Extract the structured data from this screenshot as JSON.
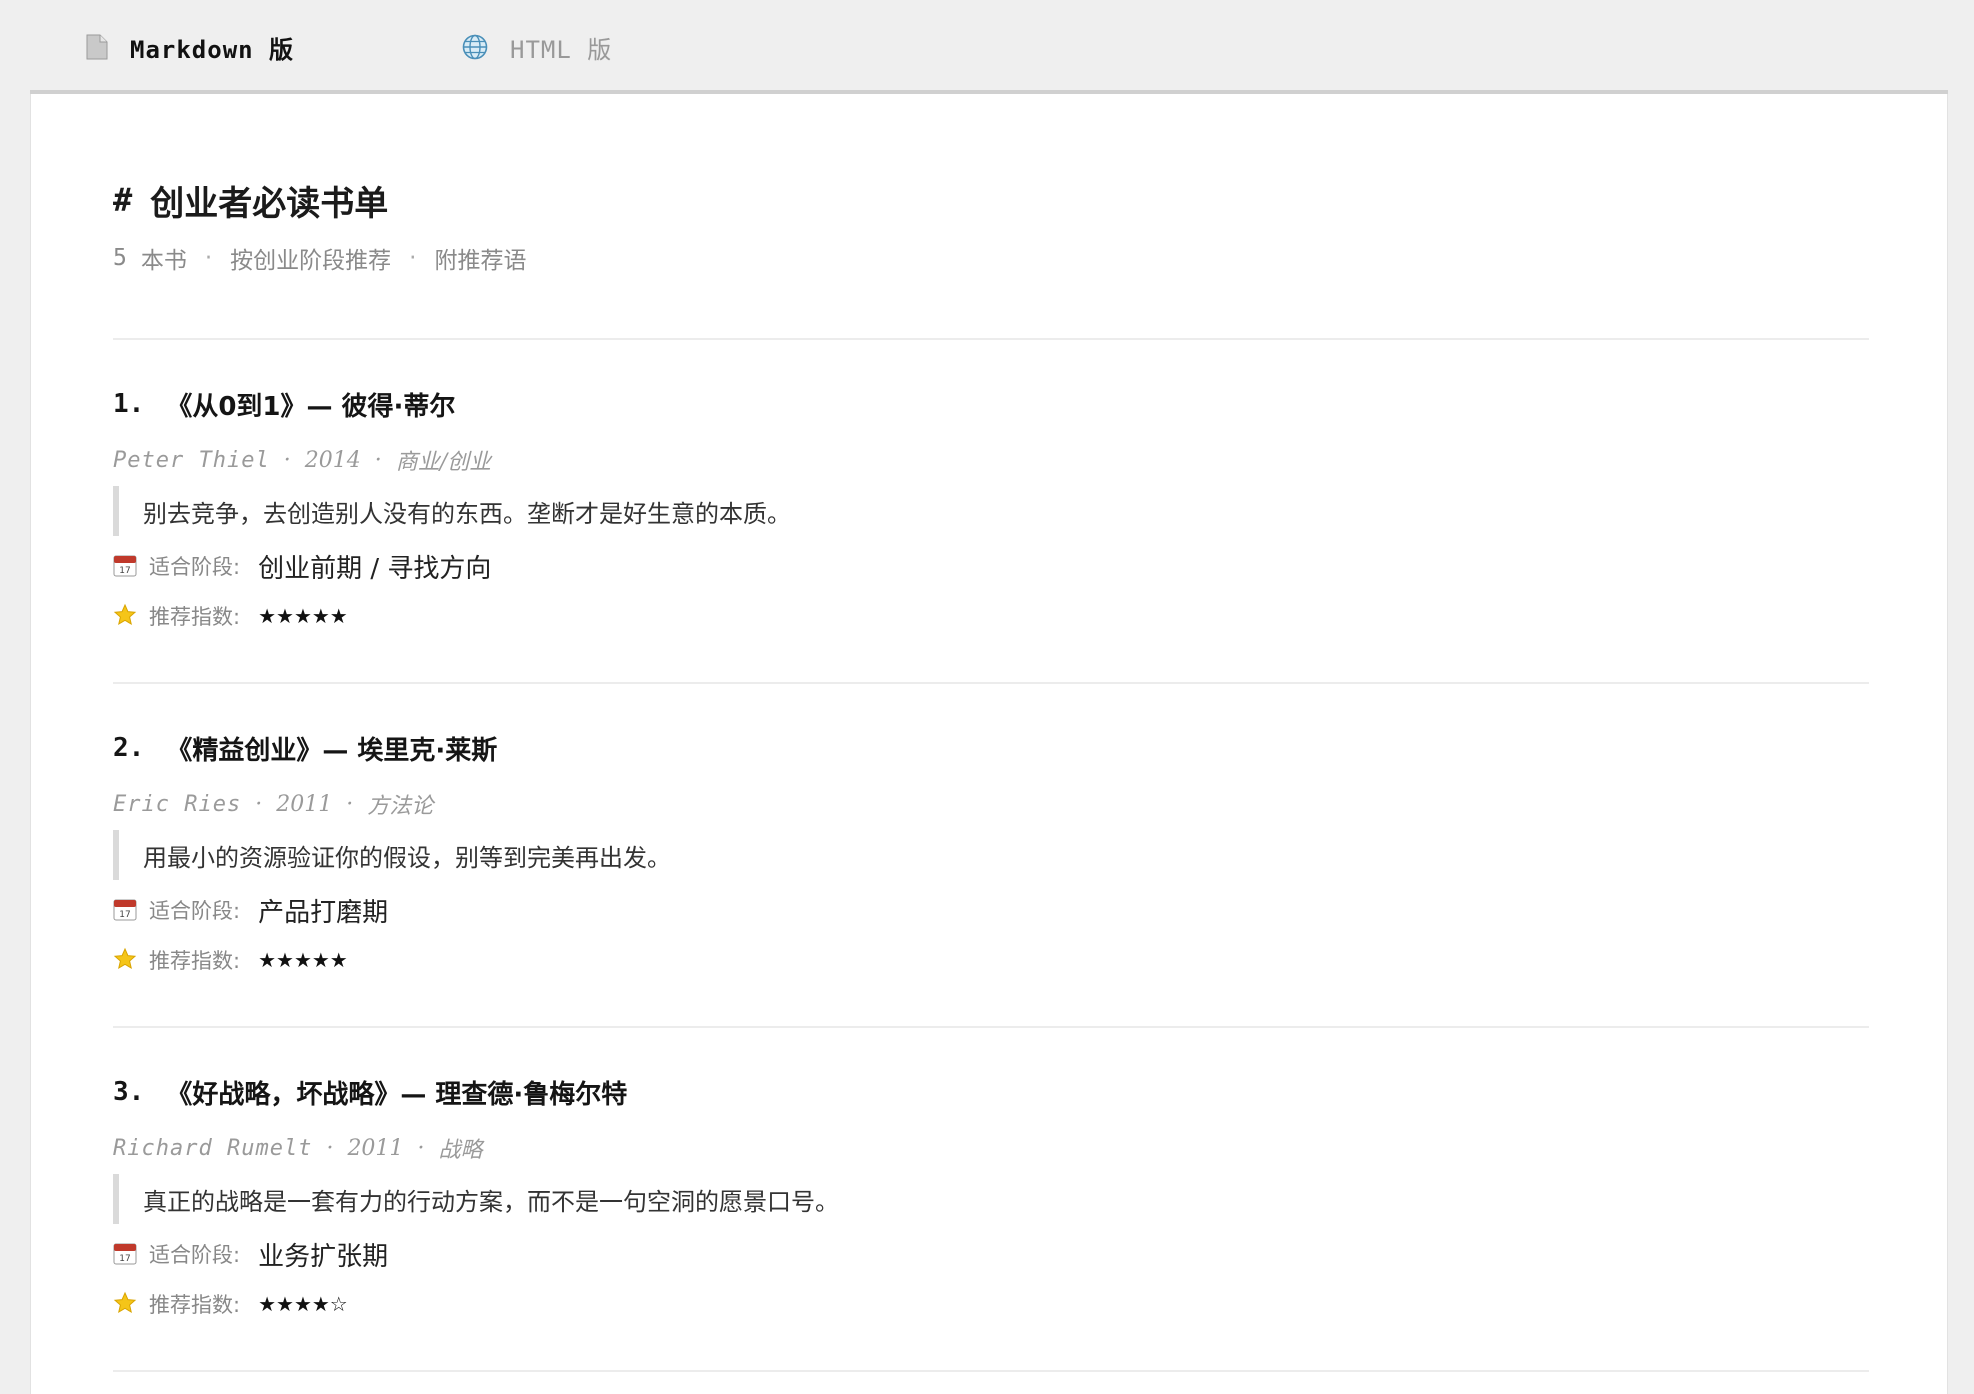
{
  "tabs": [
    {
      "label": "Markdown 版",
      "icon": "document-icon",
      "active": true
    },
    {
      "label": "HTML 版",
      "icon": "globe-icon",
      "active": false
    }
  ],
  "doc": {
    "hash": "#",
    "title": "创业者必读书单",
    "meta": {
      "count": "5",
      "count_unit": "本书",
      "item2": "按创业阶段推荐",
      "item3": "附推荐语",
      "separator": "·"
    }
  },
  "labels": {
    "stage": "适合阶段:",
    "rating": "推荐指数:"
  },
  "books": [
    {
      "index": "1.",
      "title": "《从0到1》— 彼得·蒂尔",
      "author": "Peter Thiel",
      "year": "2014",
      "category": "商业/创业",
      "quote": "别去竞争，去创造别人没有的东西。垄断才是好生意的本质。",
      "stage": "创业前期 / 寻找方向",
      "stars": "★★★★★",
      "rating": 5
    },
    {
      "index": "2.",
      "title": "《精益创业》— 埃里克·莱斯",
      "author": "Eric Ries",
      "year": "2011",
      "category": "方法论",
      "quote": "用最小的资源验证你的假设，别等到完美再出发。",
      "stage": "产品打磨期",
      "stars": "★★★★★",
      "rating": 5
    },
    {
      "index": "3.",
      "title": "《好战略，坏战略》— 理查德·鲁梅尔特",
      "author": "Richard Rumelt",
      "year": "2011",
      "category": "战略",
      "quote": "真正的战略是一套有力的行动方案，而不是一句空洞的愿景口号。",
      "stage": "业务扩张期",
      "stars": "★★★★☆",
      "rating": 4
    }
  ]
}
